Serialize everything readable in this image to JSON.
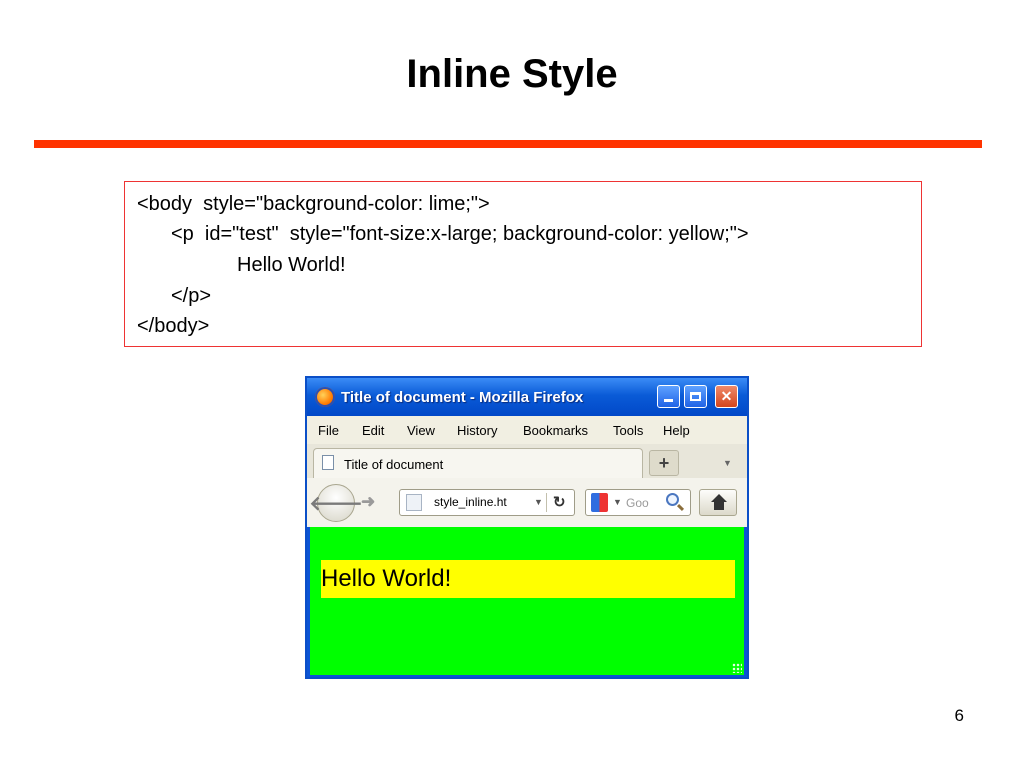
{
  "slide": {
    "title": "Inline Style",
    "page_number": "6",
    "accent_color": "#ff3300"
  },
  "code": {
    "lines": [
      "<body  style=\"background-color: lime;\">",
      "<p  id=\"test\"  style=\"font-size:x-large; background-color: yellow;\">",
      "Hello World!",
      "</p>",
      "</body>"
    ]
  },
  "browser": {
    "window_title": "Title of document - Mozilla Firefox",
    "menu": [
      "File",
      "Edit",
      "View",
      "History",
      "Bookmarks",
      "Tools",
      "Help"
    ],
    "tab_title": "Title of document",
    "new_tab_glyph": "+",
    "url": "style_inline.ht",
    "search_placeholder": "Goo",
    "icons": {
      "app": "firefox-logo-icon",
      "back": "back-arrow-icon",
      "forward": "forward-arrow-icon",
      "reload": "reload-icon",
      "search": "search-icon",
      "home": "home-icon"
    },
    "page_background": "#00ff00",
    "paragraph": {
      "text": "Hello World!",
      "background": "#ffff00"
    }
  }
}
